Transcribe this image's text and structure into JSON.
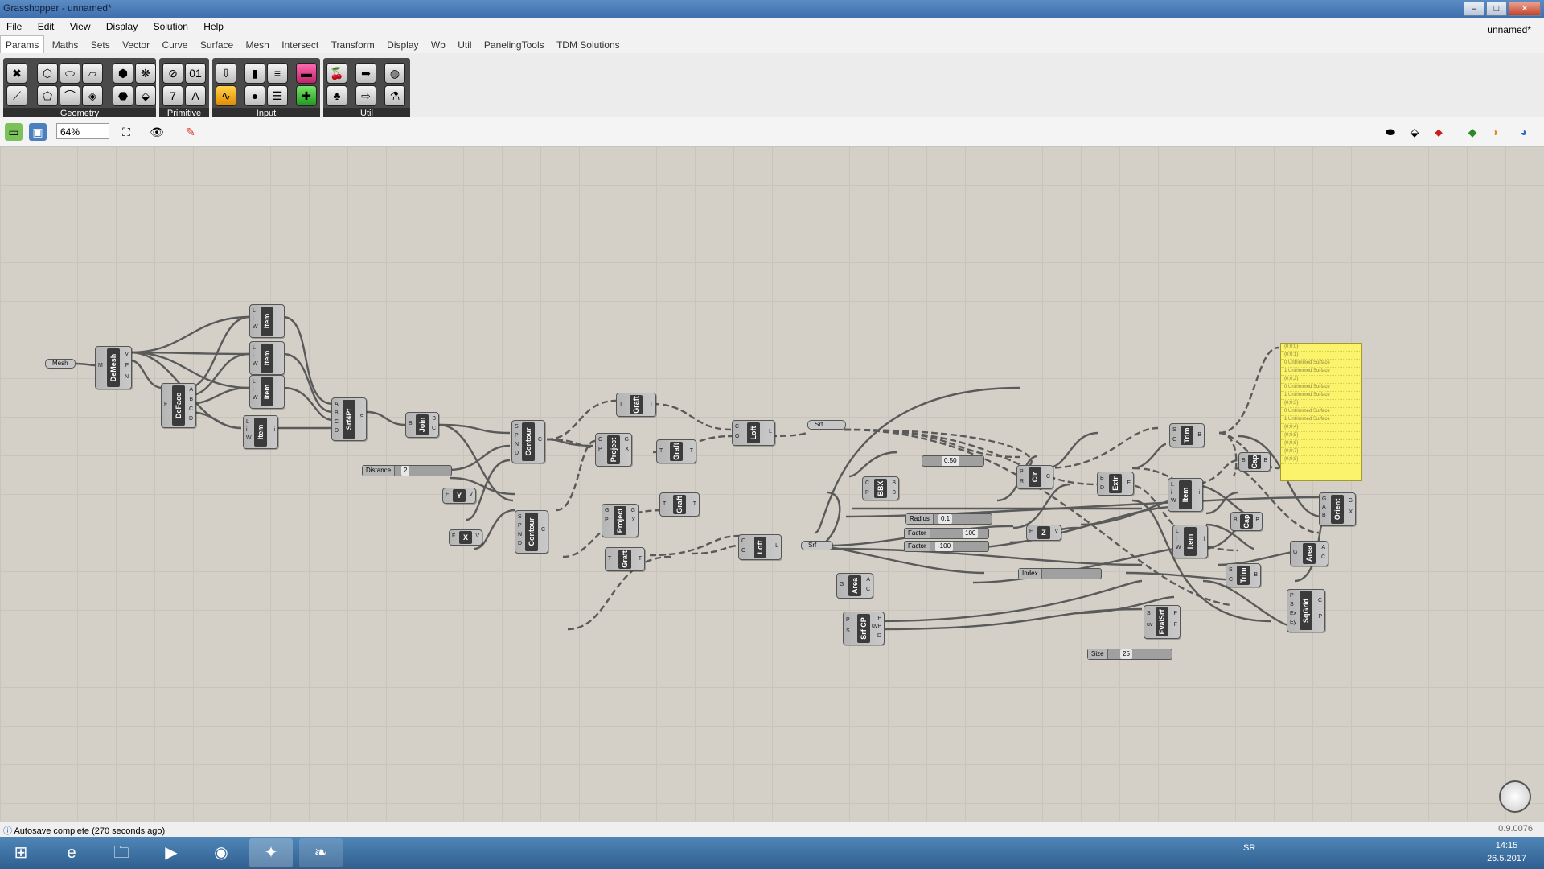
{
  "window": {
    "title": "Grasshopper - unnamed*",
    "doc_name": "unnamed*"
  },
  "menu": [
    "File",
    "Edit",
    "View",
    "Display",
    "Solution",
    "Help"
  ],
  "tabs": [
    "Params",
    "Maths",
    "Sets",
    "Vector",
    "Curve",
    "Surface",
    "Mesh",
    "Intersect",
    "Transform",
    "Display",
    "Wb",
    "Util",
    "PanelingTools",
    "TDM Solutions"
  ],
  "ribbon_groups": [
    "Geometry",
    "Primitive",
    "Input",
    "Util"
  ],
  "toolbar": {
    "zoom": "64%"
  },
  "nodes": {
    "mesh": "Mesh",
    "demesh": "DeMesh",
    "deface": "DeFace",
    "item": "Item",
    "srf4pt": "Srf4Pt",
    "join": "Join",
    "contour": "Contour",
    "graft": "Graft",
    "project": "Project",
    "loft": "Loft",
    "srf": "Srf",
    "bbx": "BBX",
    "area": "Area",
    "srfcp": "Srf CP",
    "extr": "Extr",
    "trim": "Trim",
    "cap": "Cap",
    "orient": "Orient",
    "evalsrf": "EvalSrf",
    "sqgrid": "SqGrid",
    "y": "Y",
    "x": "X",
    "z": "Z",
    "cir": "Cir"
  },
  "sliders": {
    "distance": {
      "label": "Distance",
      "value": "2"
    },
    "top": {
      "value": "0.50"
    },
    "radius": {
      "label": "Radius",
      "value": "0.1"
    },
    "factor1": {
      "label": "Factor",
      "value": "100"
    },
    "factor2": {
      "label": "Factor",
      "value": "-100"
    },
    "index": {
      "label": "Index",
      "value": ""
    },
    "size": {
      "label": "Size",
      "value": "25"
    }
  },
  "panel": {
    "rows": [
      "{0;0;0}",
      "{0;0;1}",
      "0 Untrimmed Surface",
      "1 Untrimmed Surface",
      "{0;0;2}",
      "0 Untrimmed Surface",
      "1 Untrimmed Surface",
      "{0;0;3}",
      "0 Untrimmed Surface",
      "1 Untrimmed Surface",
      "{0;0;4}",
      "{0;0;5}",
      "{0;0;6}",
      "{0;0;7}",
      "{0;0;8}"
    ]
  },
  "status": {
    "message": "Autosave complete (270 seconds ago)",
    "version": "0.9.0076"
  },
  "taskbar": {
    "lang": "SR",
    "time": "14:15",
    "date": "26.5.2017"
  },
  "colors": {
    "canvas": "#d4d0c8",
    "panel": "#fbf36b",
    "title": "#4a7db8"
  }
}
